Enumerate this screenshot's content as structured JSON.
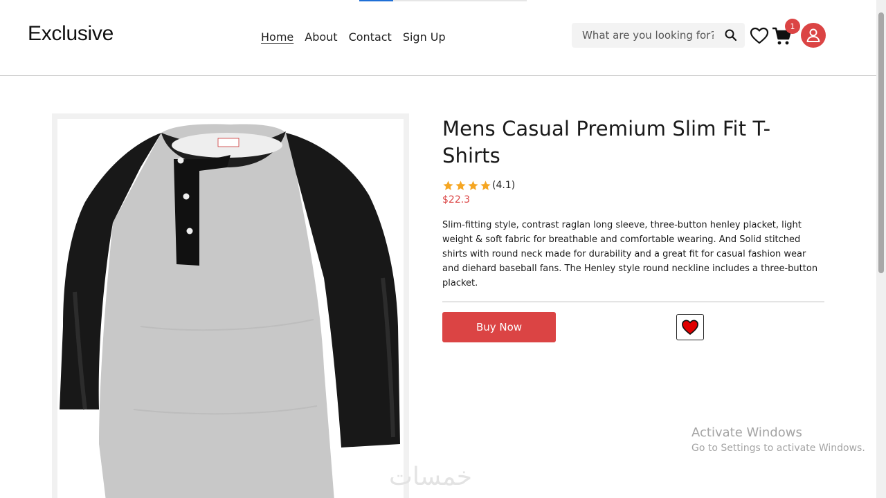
{
  "brand": {
    "name": "Exclusive"
  },
  "nav": {
    "items": [
      {
        "label": "Home",
        "active": true
      },
      {
        "label": "About",
        "active": false
      },
      {
        "label": "Contact",
        "active": false
      },
      {
        "label": "Sign Up",
        "active": false
      }
    ]
  },
  "search": {
    "placeholder": "What are you looking for?",
    "value": ""
  },
  "header_icons": {
    "wishlist": "heart-outline-icon",
    "cart": "cart-icon",
    "cart_count": "1",
    "account": "user-icon"
  },
  "product": {
    "title": "Mens Casual Premium Slim Fit T-Shirts",
    "rating_value": 4.1,
    "rating_text": "(4.1)",
    "price": "$22.3",
    "description": "Slim-fitting style, contrast raglan long sleeve, three-button henley placket, light weight & soft fabric for breathable and comfortable wearing. And Solid stitched shirts with round neck made for durability and a great fit for casual fashion wear and diehard baseball fans. The Henley style round neckline includes a three-button placket.",
    "buy_label": "Buy Now",
    "favorite_icon": "heart-filled-icon",
    "image_alt": "raglan henley t-shirt"
  },
  "os_overlay": {
    "line1": "Activate Windows",
    "line2": "Go to Settings to activate Windows."
  },
  "watermark": {
    "text": "خمسات"
  },
  "colors": {
    "accent": "#db4444",
    "text": "#111111",
    "star": "#f5a623"
  }
}
